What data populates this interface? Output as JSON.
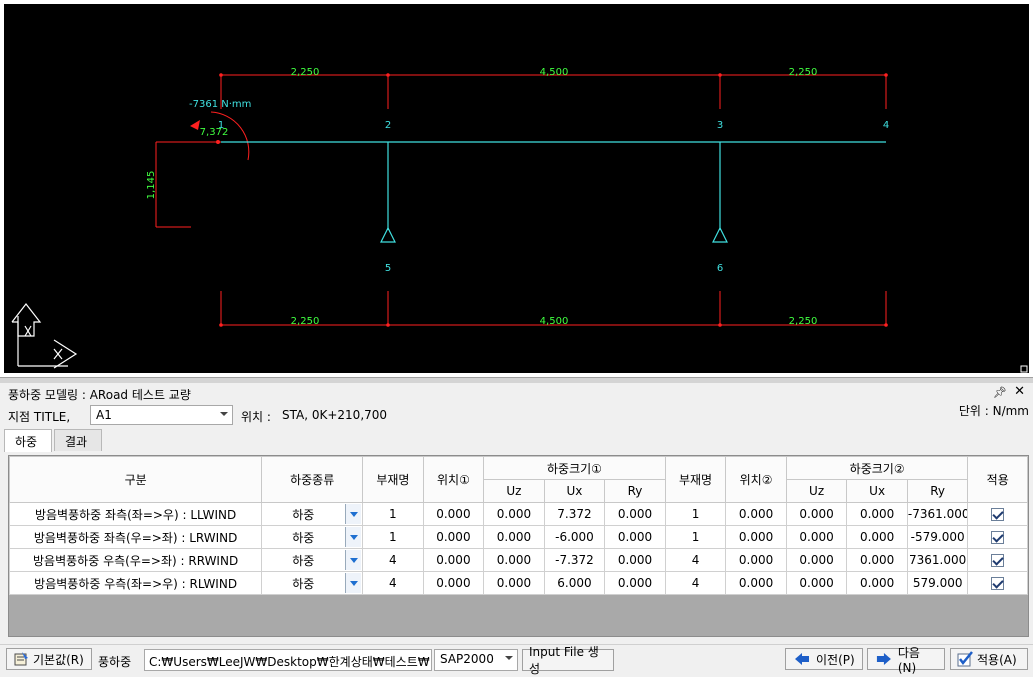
{
  "drawing": {
    "dims_top": [
      "2,250",
      "4,500",
      "2,250"
    ],
    "dims_bottom": [
      "2,250",
      "4,500",
      "2,250"
    ],
    "moment_label": "-7361 N·mm",
    "force_label": "7,372",
    "height_label": "1,145",
    "nodes": [
      "1",
      "2",
      "3",
      "4",
      "5",
      "6"
    ]
  },
  "panel": {
    "title": "풍하중 모델링 : ARoad 테스트 교량",
    "pin": "ᅟ⊣",
    "close": "✕",
    "unit": "단위 : N/mm"
  },
  "filter": {
    "point_label": "지점 TITLE,",
    "point_value": "A1",
    "location_label": "위치 :",
    "location_value": "STA, 0K+210,700"
  },
  "tabs": [
    "하중",
    "결과"
  ],
  "table": {
    "headers": {
      "category": "구분",
      "load_type": "하중종류",
      "member1": "부재명",
      "pos1": "위치①",
      "size1": "하중크기①",
      "member2": "부재명",
      "pos2": "위치②",
      "size2": "하중크기②",
      "apply": "적용",
      "uz": "Uz",
      "ux": "Ux",
      "ry": "Ry"
    },
    "rows": [
      {
        "name": "방음벽풍하중 좌측(좌=>우) : LLWIND",
        "kind": "하중",
        "m1": "1",
        "p1": "0.000",
        "uz1": "0.000",
        "ux1": "7.372",
        "ry1": "0.000",
        "m2": "1",
        "p2": "0.000",
        "uz2": "0.000",
        "ux2": "0.000",
        "ry2": "-7361.000",
        "apply": true
      },
      {
        "name": "방음벽풍하중 좌측(우=>좌) : LRWIND",
        "kind": "하중",
        "m1": "1",
        "p1": "0.000",
        "uz1": "0.000",
        "ux1": "-6.000",
        "ry1": "0.000",
        "m2": "1",
        "p2": "0.000",
        "uz2": "0.000",
        "ux2": "0.000",
        "ry2": "-579.000",
        "apply": true
      },
      {
        "name": "방음벽풍하중 우측(우=>좌) : RRWIND",
        "kind": "하중",
        "m1": "4",
        "p1": "0.000",
        "uz1": "0.000",
        "ux1": "-7.372",
        "ry1": "0.000",
        "m2": "4",
        "p2": "0.000",
        "uz2": "0.000",
        "ux2": "0.000",
        "ry2": "7361.000",
        "apply": true
      },
      {
        "name": "방음벽풍하중 우측(좌=>우) : RLWIND",
        "kind": "하중",
        "m1": "4",
        "p1": "0.000",
        "uz1": "0.000",
        "ux1": "6.000",
        "ry1": "0.000",
        "m2": "4",
        "p2": "0.000",
        "uz2": "0.000",
        "ux2": "0.000",
        "ry2": "579.000",
        "apply": true
      }
    ]
  },
  "bottom": {
    "default_btn": "기본값(R)",
    "wind_label": "풍하중",
    "path_value": "C:₩Users₩LeeJW₩Desktop₩한계상태₩테스트₩",
    "solver_value": "SAP2000",
    "input_btn": "Input File 생성",
    "prev_btn": "이전(P)",
    "next_btn": "다음(N)",
    "apply_btn": "적용(A)"
  },
  "colors": {
    "cad_bg": "#000000",
    "dim_red": "#ff2020",
    "member_cyan": "#40e0e0",
    "text_green": "#40ff40",
    "arrow_blue": "#1e5fc8"
  }
}
